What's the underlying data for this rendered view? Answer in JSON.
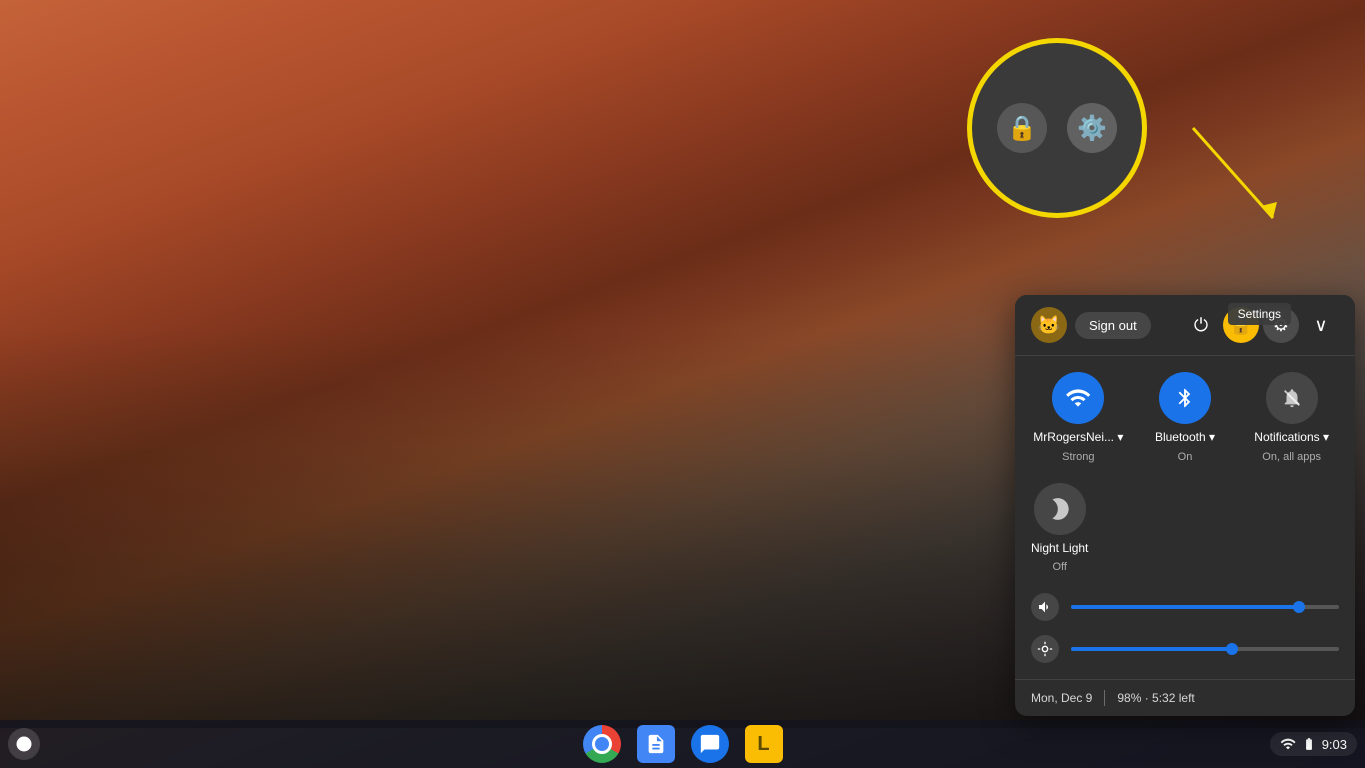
{
  "desktop": {
    "background": "city-sunset"
  },
  "taskbar": {
    "launcher_icon": "⬤",
    "apps": [
      {
        "name": "Chrome",
        "icon": "chrome"
      },
      {
        "name": "Google Docs",
        "icon": "docs"
      },
      {
        "name": "Messages",
        "icon": "messages"
      },
      {
        "name": "Keep",
        "icon": "keep"
      }
    ],
    "time": "9:03",
    "wifi_icon": "wifi",
    "battery_icon": "battery"
  },
  "quick_settings": {
    "avatar_emoji": "🐱",
    "sign_out_label": "Sign out",
    "power_tooltip": "Power",
    "lock_tooltip": "Lock",
    "settings_tooltip": "Settings",
    "chevron_tooltip": "Collapse",
    "tiles": [
      {
        "id": "wifi",
        "label": "MrRogersNei...",
        "sublabel": "Strong",
        "state": "active",
        "icon": "wifi"
      },
      {
        "id": "bluetooth",
        "label": "Bluetooth",
        "sublabel": "On",
        "state": "active",
        "icon": "bluetooth"
      },
      {
        "id": "notifications",
        "label": "Notifications",
        "sublabel": "On, all apps",
        "state": "inactive",
        "icon": "notifications"
      }
    ],
    "night_light": {
      "label": "Night Light",
      "sublabel": "Off",
      "state": "inactive"
    },
    "volume_level": 85,
    "brightness_level": 60,
    "date": "Mon, Dec 9",
    "battery": "98% · 5:32 left",
    "settings_tooltip_text": "Settings"
  },
  "annotation": {
    "circle_visible": true,
    "arrow_visible": true
  }
}
